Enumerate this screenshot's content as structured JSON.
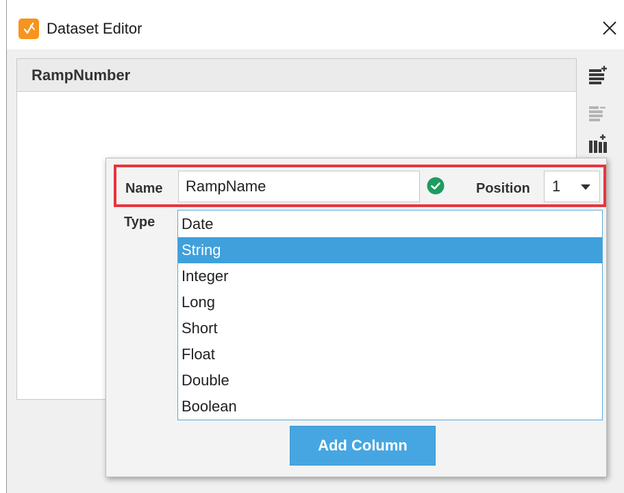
{
  "window": {
    "title": "Dataset Editor",
    "icon": "ignition-app-icon",
    "accent_color": "#f7941d"
  },
  "table": {
    "columns": [
      "RampNumber"
    ]
  },
  "toolbar": {
    "items": [
      {
        "icon": "add-column-icon"
      },
      {
        "icon": "remove-column-icon"
      },
      {
        "icon": "add-row-icon"
      }
    ]
  },
  "column_editor": {
    "name_label": "Name",
    "name_value": "RampName",
    "name_valid": true,
    "position_label": "Position",
    "position_value": "1",
    "type_label": "Type",
    "types": [
      "Date",
      "String",
      "Integer",
      "Long",
      "Short",
      "Float",
      "Double",
      "Boolean"
    ],
    "selected_type": "String",
    "add_button": "Add Column",
    "highlight_color": "#e8343c",
    "selection_color": "#3fa0dc"
  }
}
